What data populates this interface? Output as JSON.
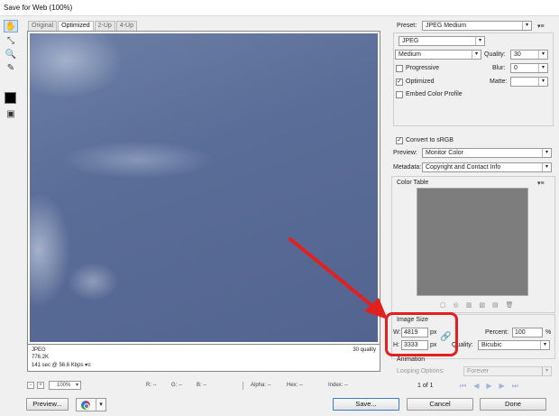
{
  "window": {
    "title": "Save for Web (100%)"
  },
  "tabs": [
    "Original",
    "Optimized",
    "2-Up",
    "4-Up"
  ],
  "image_info": {
    "format": "JPEG",
    "size": "776.2K",
    "time": "141 sec @ 56.6 Kbps",
    "menu": "▾≡",
    "quality": "30 quality"
  },
  "zoom": {
    "minus": "−",
    "plus": "+",
    "level": "100%",
    "r": "R: --",
    "g": "G: --",
    "b": "B: --",
    "alpha": "Alpha: --",
    "hex": "Hex: --",
    "index": "Index: --"
  },
  "buttons": {
    "preview": "Preview...",
    "save": "Save...",
    "cancel": "Cancel",
    "done": "Done",
    "browser_arrow": "▾"
  },
  "settings": {
    "preset_label": "Preset:",
    "preset_value": "JPEG Medium",
    "format_value": "JPEG",
    "quality_level": "Medium",
    "quality_label": "Quality:",
    "quality_value": "30",
    "progressive_label": "Progressive",
    "blur_label": "Blur:",
    "blur_value": "0",
    "optimized_label": "Optimized",
    "matte_label": "Matte:",
    "matte_value": "",
    "embed_label": "Embed Color Profile",
    "convert_label": "Convert to sRGB",
    "preview_label": "Preview:",
    "preview_value": "Monitor Color",
    "metadata_label": "Metadata:",
    "metadata_value": "Copyright and Contact Info",
    "checkmark": "✓",
    "arrow": "▾",
    "menu": "▾≡"
  },
  "color_table": {
    "title": "Color Table",
    "menu": "▾≡"
  },
  "image_size": {
    "title": "Image Size",
    "w_label": "W:",
    "w_value": "4819",
    "h_label": "H:",
    "h_value": "3333",
    "unit": "px",
    "percent_label": "Percent:",
    "percent_value": "100",
    "percent_unit": "%",
    "quality_label": "Quality:",
    "quality_value": "Bicubic"
  },
  "animation": {
    "title": "Animation",
    "looping_label": "Looping Options:",
    "looping_value": "Forever",
    "frame": "1 of 1"
  },
  "colors": {
    "accent": "#3b7bd4",
    "highlight": "#e32020"
  }
}
